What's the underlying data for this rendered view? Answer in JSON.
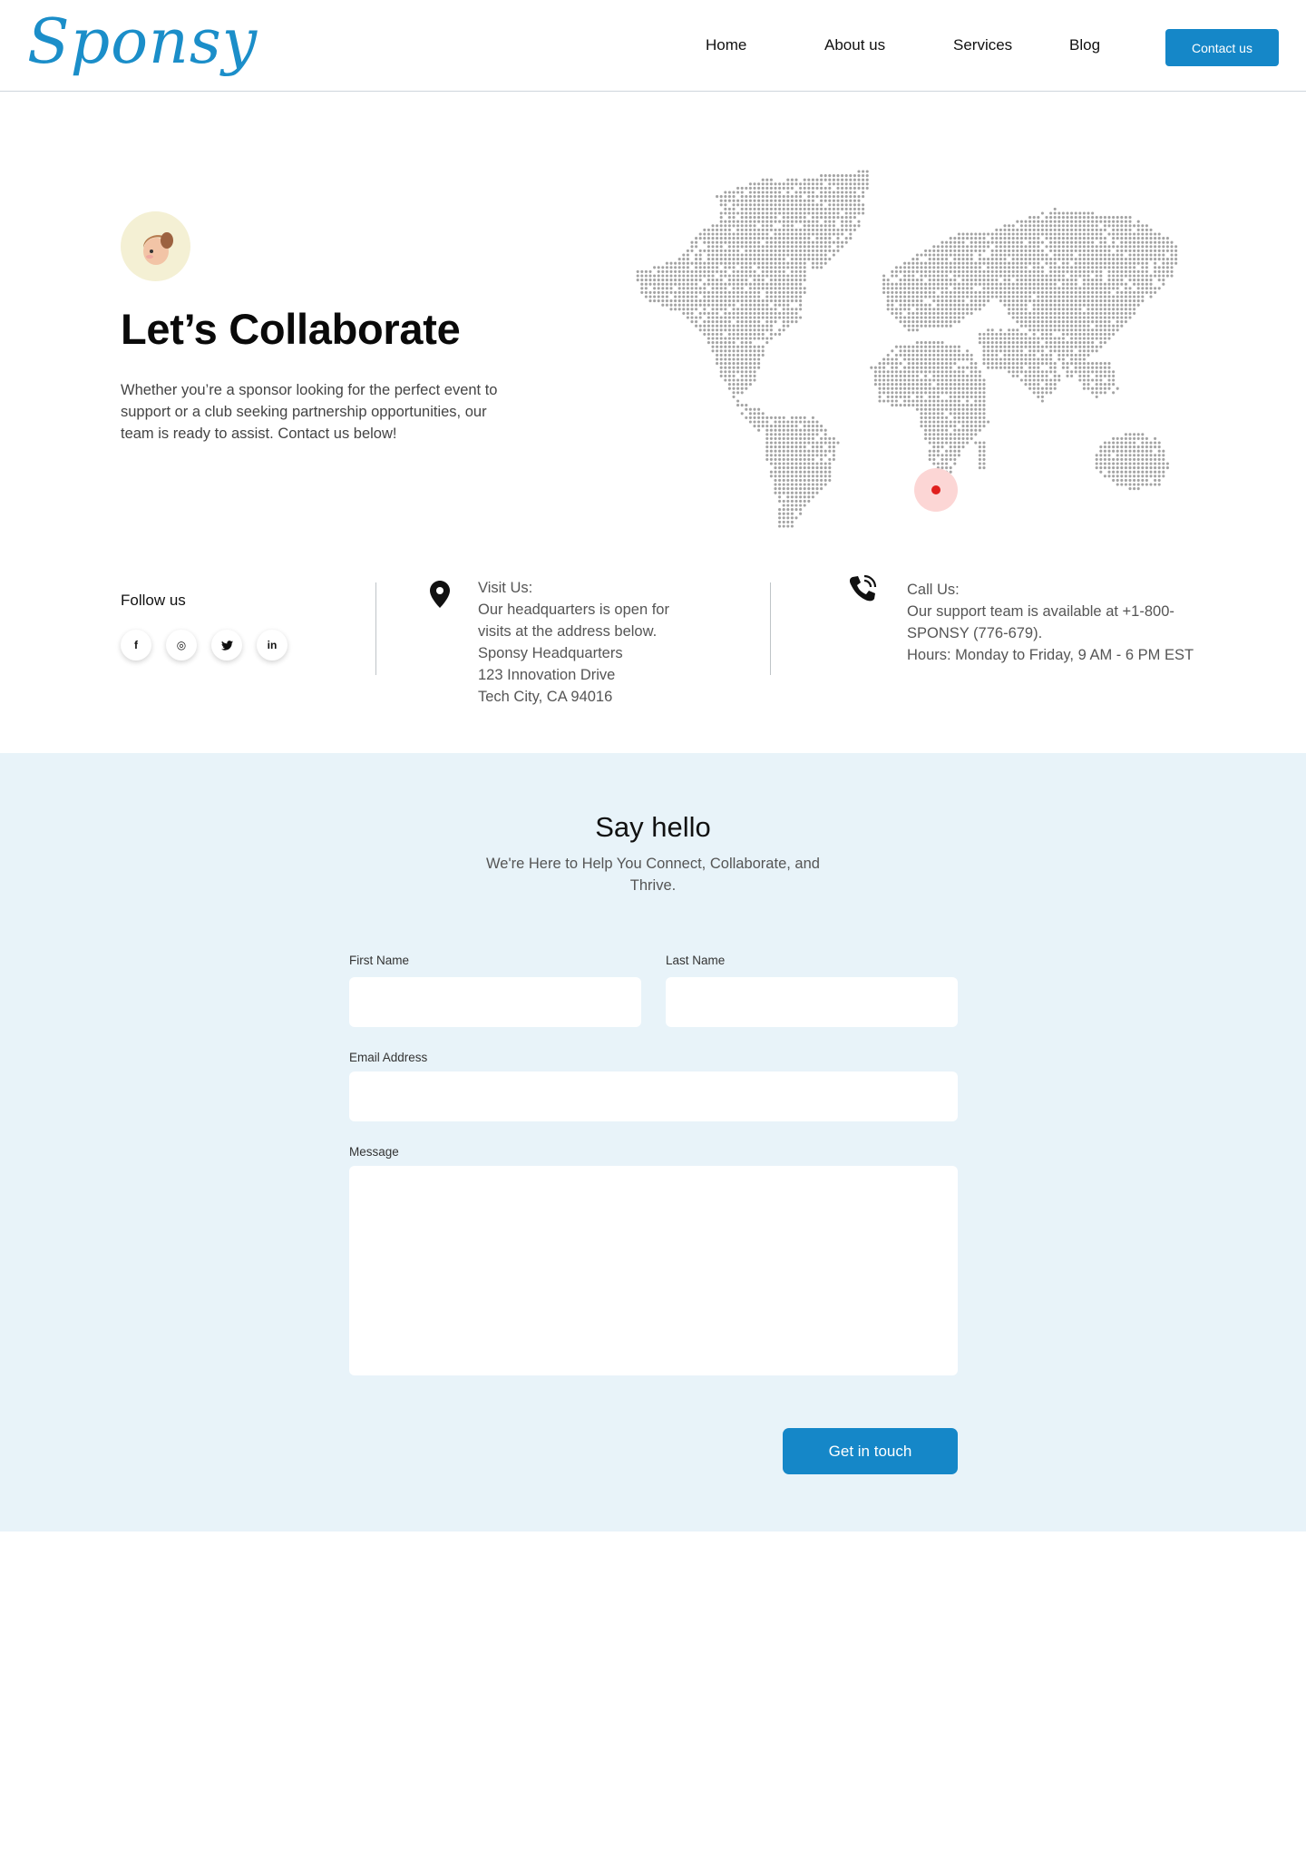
{
  "brand": {
    "logo": "Sponsy",
    "accent": "#1587c8"
  },
  "nav": {
    "items": [
      {
        "label": "Home"
      },
      {
        "label": "About us"
      },
      {
        "label": "Services"
      },
      {
        "label": "Blog"
      }
    ],
    "cta": "Contact us"
  },
  "hero": {
    "title": "Let’s Collaborate",
    "text": "Whether you’re a sponsor looking for the perfect event to support or a club seeking partnership opportunities, our team is ready to assist. Contact us below!",
    "marker_color": "#e0201e"
  },
  "follow": {
    "label": "Follow us",
    "socials": [
      {
        "icon": "facebook-icon",
        "glyph": "f"
      },
      {
        "icon": "instagram-icon",
        "glyph": "◎"
      },
      {
        "icon": "twitter-icon",
        "glyph": "🐦"
      },
      {
        "icon": "linkedin-icon",
        "glyph": "in"
      }
    ]
  },
  "visit": {
    "title": "Visit Us:",
    "lines": [
      "Our headquarters is open for",
      "visits at the address below.",
      "Sponsy Headquarters",
      "123 Innovation Drive",
      "Tech City, CA 94016"
    ]
  },
  "call": {
    "title": "Call Us:",
    "lines": [
      "Our support team is available at +1-800-",
      "SPONSY (776-679).",
      "Hours: Monday to Friday, 9 AM - 6 PM EST"
    ]
  },
  "contact_form": {
    "title": "Say hello",
    "subtitle": "We're Here to Help You Connect, Collaborate, and Thrive.",
    "first_name_label": "First Name",
    "first_name_value": "",
    "last_name_label": "Last Name",
    "last_name_value": "",
    "email_label": "Email Address",
    "email_value": "",
    "message_label": "Message",
    "message_value": "",
    "submit": "Get in touch"
  }
}
